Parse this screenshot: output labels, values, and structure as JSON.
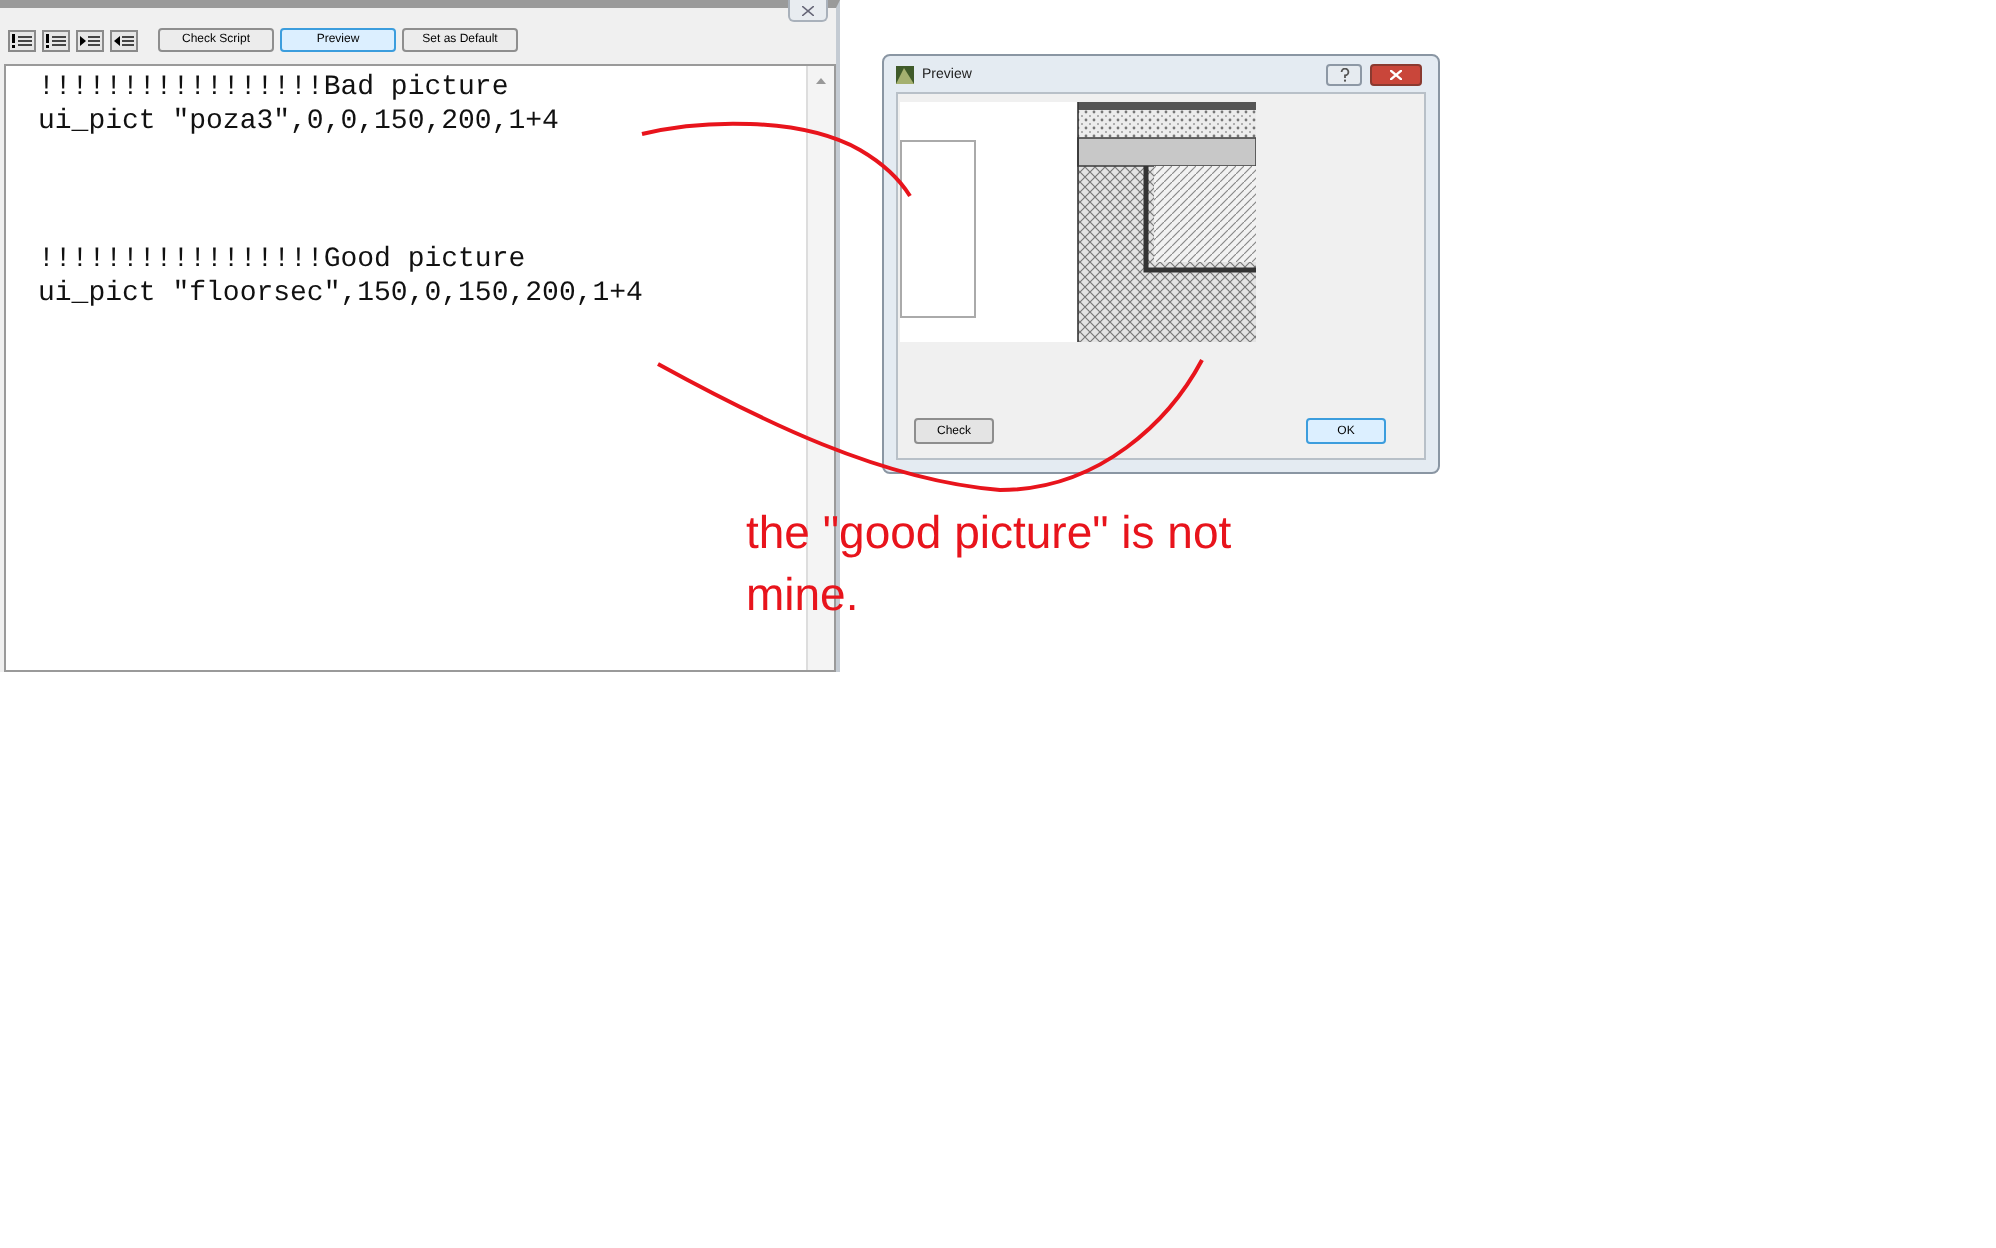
{
  "editor": {
    "toolbar": {
      "icon_buttons": [
        {
          "kind": "bang-lines"
        },
        {
          "kind": "bang-lines"
        },
        {
          "kind": "indent"
        },
        {
          "kind": "outdent"
        }
      ],
      "buttons": [
        {
          "label": "Check Script",
          "selected": false
        },
        {
          "label": "Preview",
          "selected": true
        },
        {
          "label": "Set as Default",
          "selected": false
        }
      ]
    },
    "code_blocks": [
      {
        "lines": [
          "!!!!!!!!!!!!!!!!!Bad picture",
          "ui_pict \"poza3\",0,0,150,200,1+4"
        ]
      },
      {
        "lines": [
          "!!!!!!!!!!!!!!!!!Good picture",
          "ui_pict \"floorsec\",150,0,150,200,1+4"
        ]
      }
    ]
  },
  "preview_dialog": {
    "title": "Preview",
    "buttons": [
      {
        "label": "Check",
        "selected": false
      },
      {
        "label": "OK",
        "selected": true
      }
    ]
  },
  "annotation": {
    "text": "the \"good picture\" is not mine."
  }
}
